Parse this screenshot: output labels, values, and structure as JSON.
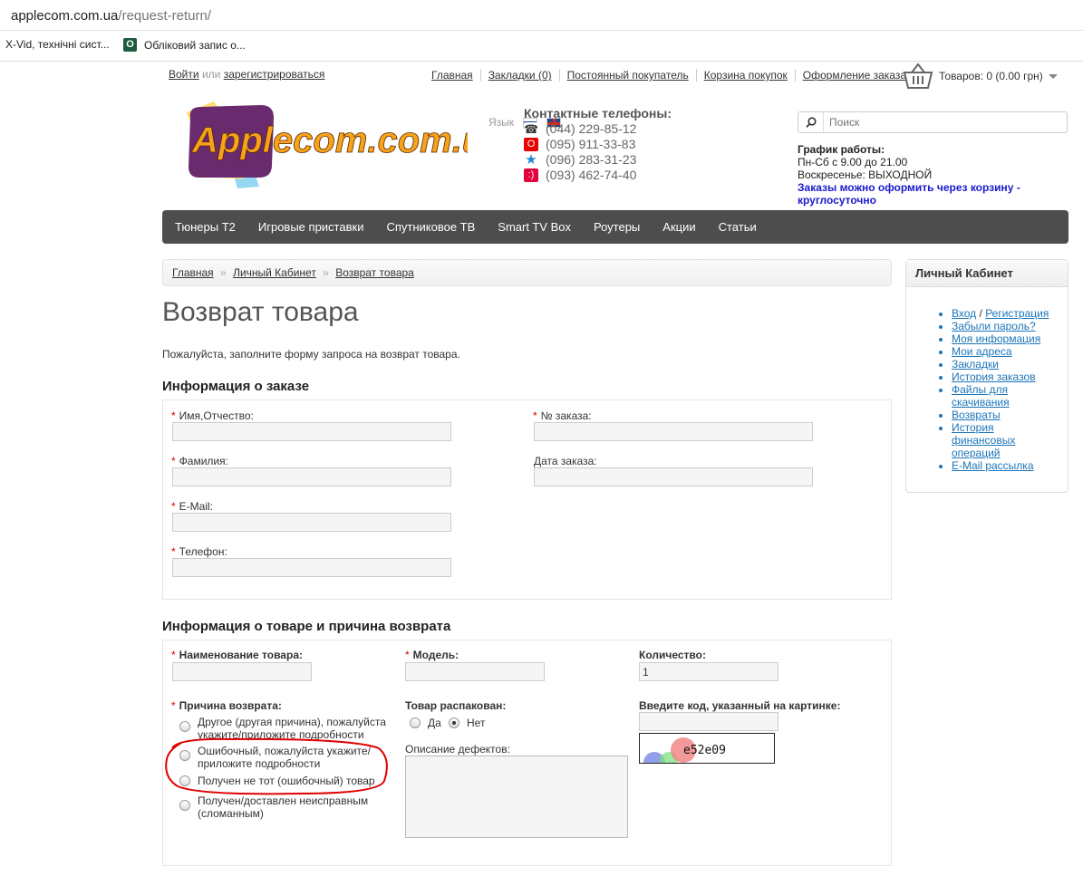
{
  "browser": {
    "url_host": "applecom.com.ua",
    "url_path": "/request-return/",
    "bookmarks": [
      "X-Vid, технічні сист...",
      "Обліковий запис о..."
    ]
  },
  "header": {
    "login": "Войти",
    "or": "или",
    "register": "зарегистрироваться",
    "nav": [
      "Главная",
      "Закладки (0)",
      "Постоянный покупатель",
      "Корзина покупок",
      "Оформление заказа"
    ],
    "cart": "Товаров: 0 (0.00 грн)",
    "logo_text": "Applecom.com.ua",
    "lang_label": "Язык",
    "phones_title": "Контактные телефоны:",
    "phones": [
      "(044) 229-85-12",
      "(095) 911-33-83",
      "(096) 283-31-23",
      "(093) 462-74-40"
    ],
    "search_placeholder": "Поиск",
    "schedule_title": "График работы:",
    "schedule_weekdays": "Пн-Сб с 9.00 до 21.00",
    "schedule_sunday": "Воскресенье: ВЫХОДНОЙ",
    "schedule_note": "Заказы можно оформить через корзину - круглосуточно"
  },
  "menu": [
    "Тюнеры Т2",
    "Игровые приставки",
    "Спутниковое ТВ",
    "Smart TV Box",
    "Роутеры",
    "Акции",
    "Статьи"
  ],
  "breadcrumb": [
    "Главная",
    "Личный Кабинет",
    "Возврат товара"
  ],
  "breadcrumb_sep": "»",
  "page": {
    "title": "Возврат товара",
    "intro": "Пожалуйста, заполните форму запроса на возврат товара."
  },
  "order_info": {
    "title": "Информация о заказе",
    "req_mark": "*",
    "firstname_label": "Имя,Отчество:",
    "lastname_label": "Фамилия:",
    "email_label": "E-Mail:",
    "phone_label": "Телефон:",
    "order_id_label": "№ заказа:",
    "order_date_label": "Дата заказа:"
  },
  "product_info": {
    "title": "Информация о товаре и причина возврата",
    "product_label": "Наименование товара:",
    "model_label": "Модель:",
    "quantity_label": "Количество:",
    "quantity_value": "1",
    "reason_label": "Причина возврата:",
    "reasons": [
      "Другое (другая причина), пожалуйста укажите/приложите подробности",
      "Ошибочный, пожалуйста укажите/ приложите подробности",
      "Получен не тот (ошибочный) товар",
      "Получен/доставлен неисправным (сломанным)"
    ],
    "opened_label": "Товар распакован:",
    "opened_yes": "Да",
    "opened_no": "Нет",
    "opened_value": "Нет",
    "defects_label": "Описание дефектов:",
    "captcha_label": "Введите код, указанный на картинке:",
    "captcha_code": "e52e09"
  },
  "sidebar": {
    "title": "Личный Кабинет",
    "login": "Вход",
    "slash": "/",
    "register": "Регистрация",
    "items": [
      "Забыли пароль?",
      "Моя информация",
      "Мои адреса",
      "Закладки",
      "История заказов",
      "Файлы для скачивания",
      "Возвраты",
      "История финансовых операций",
      "E-Mail рассылка"
    ]
  },
  "colors": {
    "menu_bg": "#4d4d4d",
    "link_blue": "#1c75b9",
    "required": "#dd0000",
    "annotation": "#e00000",
    "logo_orange": "#f7a21b",
    "logo_purple": "#6a2a6e"
  }
}
